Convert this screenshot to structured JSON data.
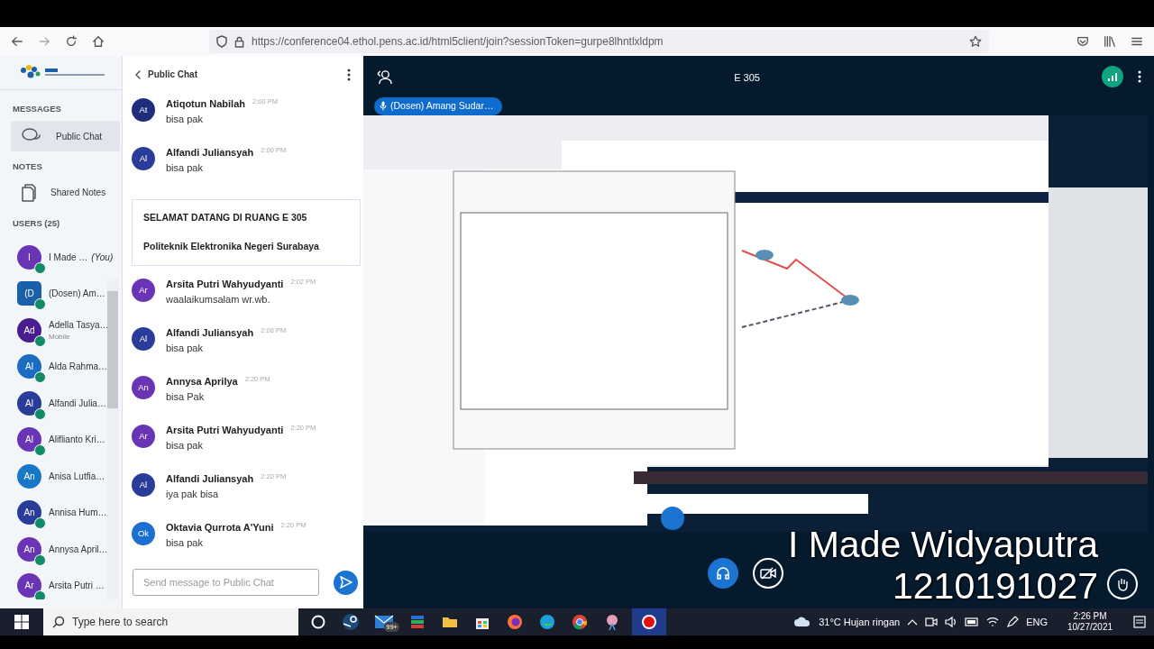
{
  "browser": {
    "url": "https://conference04.ethol.pens.ac.id/html5client/join?sessionToken=gurpe8lhntlxldpm"
  },
  "sidebar": {
    "sections": [
      {
        "heading": "MESSAGES",
        "items": [
          {
            "label": "Public Chat",
            "kind": "chat",
            "selected": true
          }
        ]
      },
      {
        "heading": "NOTES",
        "items": [
          {
            "label": "Shared Notes",
            "kind": "notes",
            "selected": false
          }
        ]
      }
    ],
    "users_heading": "USERS (25)",
    "users": [
      {
        "initials": "I",
        "name": "I Made …",
        "suffix": "(You)",
        "kind": "circle",
        "color": "#6a35b5",
        "listen_only": true
      },
      {
        "initials": "(D",
        "name": "(Dosen) Am…",
        "kind": "presenter",
        "color": "#1a5fa8",
        "listen_only": true
      },
      {
        "initials": "Ad",
        "name": "Adella Tasya…",
        "note": "Mobile",
        "kind": "circle",
        "color": "#4a1d8f",
        "listen_only": true
      },
      {
        "initials": "Al",
        "name": "Alda Rahma…",
        "kind": "circle",
        "color": "#1d6cc4",
        "listen_only": true
      },
      {
        "initials": "Al",
        "name": "Alfandi Julia…",
        "kind": "circle",
        "color": "#2a3c9a",
        "listen_only": true
      },
      {
        "initials": "Al",
        "name": "Aliflianto Kri…",
        "kind": "circle",
        "color": "#6a35b5",
        "listen_only": true
      },
      {
        "initials": "An",
        "name": "Anisa Lutfia…",
        "kind": "circle",
        "color": "#1877c6",
        "listen_only": false
      },
      {
        "initials": "An",
        "name": "Annisa Hum…",
        "kind": "circle",
        "color": "#2a3c9a",
        "listen_only": true
      },
      {
        "initials": "An",
        "name": "Annysa April…",
        "kind": "circle",
        "color": "#6a35b5",
        "listen_only": true
      },
      {
        "initials": "Ar",
        "name": "Arsita Putri …",
        "kind": "circle",
        "color": "#6a35b5",
        "listen_only": true
      }
    ]
  },
  "chat": {
    "title": "Public Chat",
    "messages": [
      {
        "kind": "message",
        "initials": "At",
        "color": "#1f2e7a",
        "name": "Atiqotun Nabilah",
        "time": "2:00 PM",
        "text": "bisa pak"
      },
      {
        "kind": "message",
        "initials": "Al",
        "color": "#2a3c9a",
        "name": "Alfandi Juliansyah",
        "time": "2:00 PM",
        "text": "bisa pak"
      },
      {
        "kind": "welcome",
        "lines": [
          "SELAMAT DATANG DI RUANG E 305",
          "Politeknik Elektronika Negeri Surabaya"
        ]
      },
      {
        "kind": "message",
        "initials": "Ar",
        "color": "#6a35b5",
        "name": "Arsita Putri Wahyudyanti",
        "time": "2:02 PM",
        "text": "waalaikumsalam wr.wb."
      },
      {
        "kind": "message",
        "initials": "Al",
        "color": "#2a3c9a",
        "name": "Alfandi Juliansyah",
        "time": "2:08 PM",
        "text": "bisa pak"
      },
      {
        "kind": "message",
        "initials": "An",
        "color": "#6a35b5",
        "name": "Annysa Aprilya",
        "time": "2:20 PM",
        "text": "bisa Pak"
      },
      {
        "kind": "message",
        "initials": "Ar",
        "color": "#6a35b5",
        "name": "Arsita Putri Wahyudyanti",
        "time": "2:20 PM",
        "text": "bisa pak"
      },
      {
        "kind": "message",
        "initials": "Al",
        "color": "#2a3c9a",
        "name": "Alfandi Juliansyah",
        "time": "2:20 PM",
        "text": "iya pak bisa"
      },
      {
        "kind": "message",
        "initials": "Ok",
        "color": "#1c6fd0",
        "name": "Oktavia Qurrota A'Yuni",
        "time": "2:20 PM",
        "text": "bisa pak"
      }
    ],
    "input": {
      "placeholder": "Send message to Public Chat"
    }
  },
  "presentation": {
    "title": "E 305",
    "presenter": "(Dosen) Amang Sudar…",
    "controls": [
      {
        "kind": "audio",
        "filled": true
      },
      {
        "kind": "video-off",
        "filled": false
      }
    ]
  },
  "caption": [
    "I Made Widyaputra",
    "1210191027"
  ],
  "taskbar": {
    "search_placeholder": "Type here to search",
    "mail_badge": "99+",
    "weather": "31°C Hujan ringan",
    "language": "ENG",
    "time": "2:26 PM",
    "date": "10/27/2021"
  }
}
